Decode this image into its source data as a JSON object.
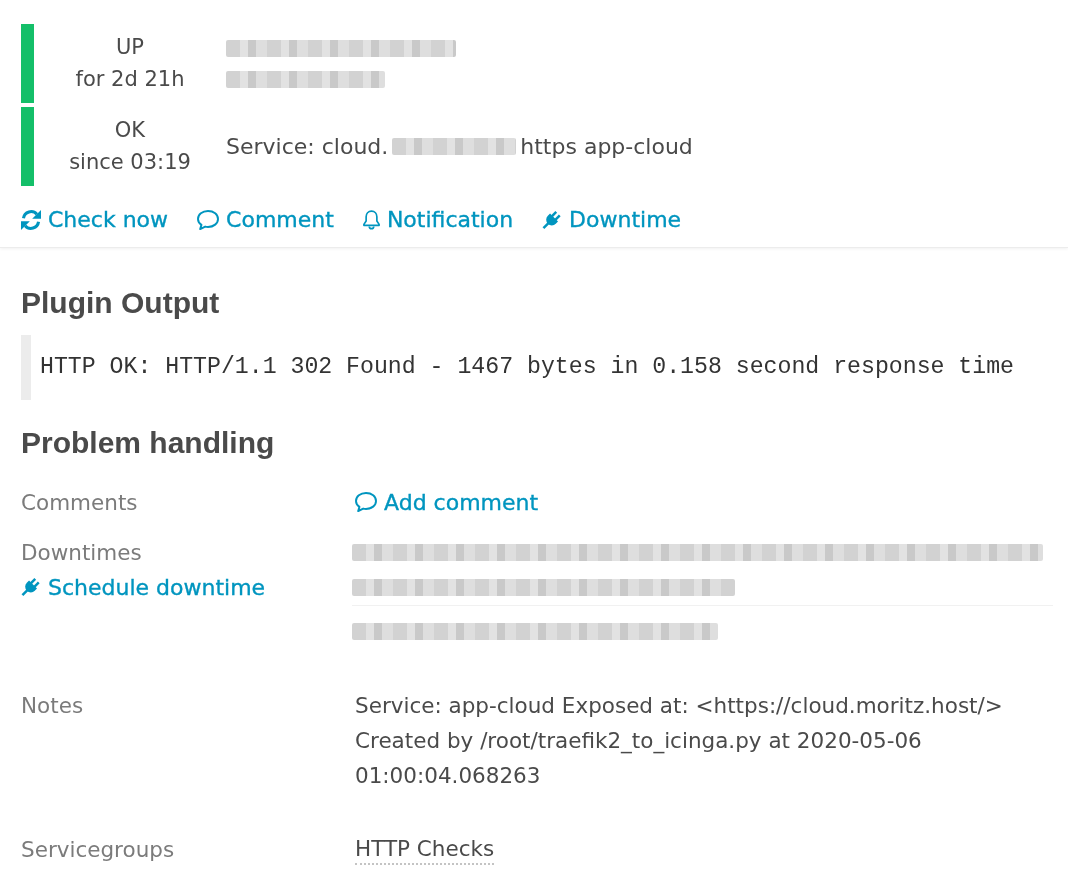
{
  "header": {
    "states": [
      {
        "kind": "host",
        "color": "#14bf69",
        "state": "UP",
        "duration": "for 2d 21h"
      },
      {
        "kind": "service",
        "color": "#14bf69",
        "state": "OK",
        "duration": "since 03:19",
        "name_start": "Service: cloud.",
        "name_end": "https app-cloud"
      }
    ],
    "actions": [
      {
        "kind": "check",
        "label": "Check now"
      },
      {
        "kind": "comment",
        "label": "Comment"
      },
      {
        "kind": "notification",
        "label": "Notification"
      },
      {
        "kind": "downtime",
        "label": "Downtime"
      }
    ]
  },
  "plugin_output": {
    "title": "Plugin Output",
    "text": "HTTP OK: HTTP/1.1 302 Found - 1467 bytes in 0.158 second response time"
  },
  "problem_handling": {
    "title": "Problem handling",
    "rows": [
      {
        "kind": "comments",
        "label": "Comments",
        "link": "Add comment"
      },
      {
        "kind": "downtimes",
        "label": "Downtimes",
        "link": "Schedule downtime"
      },
      {
        "kind": "notes",
        "label": "Notes",
        "lines": [
          "Service: app-cloud Exposed at: <https://cloud.moritz.host/>",
          "Created by /root/traefik2_to_icinga.py at 2020-05-06 01:00:04.068263"
        ]
      },
      {
        "kind": "groups",
        "label": "Servicegroups",
        "groups": [
          "HTTP Checks"
        ]
      }
    ]
  }
}
